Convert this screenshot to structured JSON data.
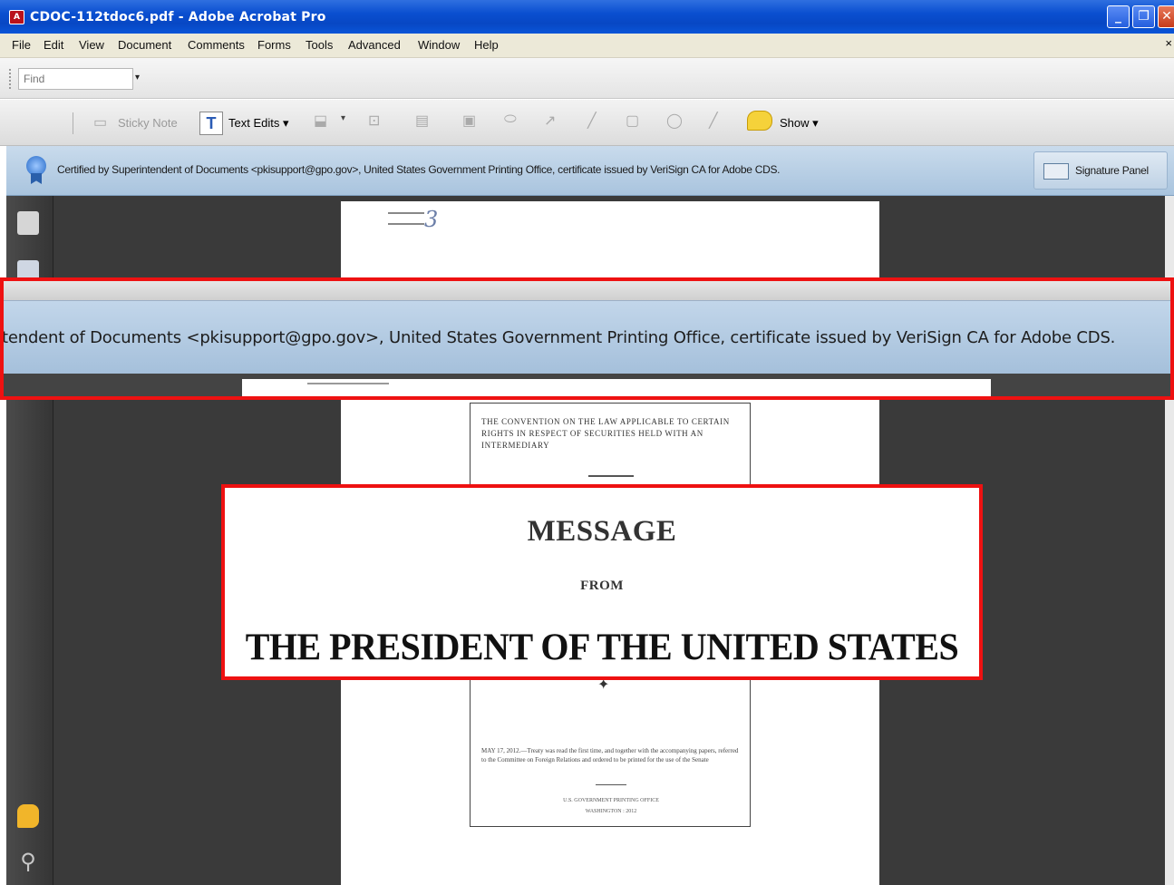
{
  "window": {
    "title": "CDOC-112tdoc6.pdf - Adobe Acrobat Pro",
    "minimize": "_",
    "maximize": "❐",
    "close": "✕"
  },
  "menu": {
    "items": [
      "File",
      "Edit",
      "View",
      "Document",
      "Comments",
      "Forms",
      "Tools",
      "Advanced",
      "Window",
      "Help"
    ],
    "close_glyph": "×"
  },
  "find": {
    "placeholder": "Find",
    "dropdown_glyph": "▾"
  },
  "toolbar": {
    "sticky_note": "Sticky Note",
    "text_edits": "Text Edits ▾",
    "show": "Show ▾"
  },
  "certificate": {
    "message": "Certified by Superintendent of Documents <pkisupport@gpo.gov>, United States Government Printing Office, certificate issued by VeriSign CA for Adobe CDS.",
    "signature_panel": "Signature Panel"
  },
  "zoom_strip": {
    "text": "tendent of Documents <pkisupport@gpo.gov>, United States Government Printing Office, certificate issued by VeriSign CA for Adobe CDS."
  },
  "document": {
    "convention_title": "THE CONVENTION ON THE LAW APPLICABLE TO CERTAIN RIGHTS IN RESPECT OF SECURITIES HELD WITH AN INTERMEDIARY",
    "heading": "MESSAGE",
    "from": "FROM",
    "president": "THE PRESIDENT OF THE UNITED STATES",
    "referral_note": "MAY 17, 2012.—Treaty was read the first time, and together with the accompanying papers, referred to the Committee on Foreign Relations and ordered to be printed for the use of the Senate",
    "printer": "U.S. GOVERNMENT PRINTING OFFICE",
    "place": "WASHINGTON : 2012"
  },
  "colors": {
    "titlebar": "#0a4fd0",
    "highlight_border": "#ee1111",
    "cert_bar": "#a9c4de",
    "workspace": "#3a3a3a"
  }
}
